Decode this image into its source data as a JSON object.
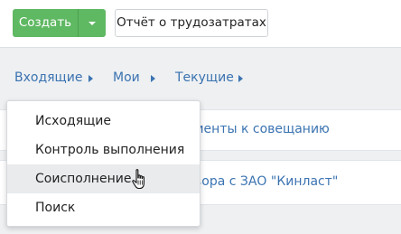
{
  "toolbar": {
    "create_label": "Создать",
    "report_label": "Отчёт о трудозатратах"
  },
  "breadcrumbs": {
    "items": [
      {
        "label": "Входящие"
      },
      {
        "label": "Мои"
      },
      {
        "label": "Текущие"
      }
    ]
  },
  "content": {
    "rows": [
      {
        "text": "менты к совещанию"
      },
      {
        "text": "вора с ЗАО \"Кинласт\""
      }
    ]
  },
  "dropdown": {
    "items": [
      {
        "label": "Исходящие"
      },
      {
        "label": "Контроль выполнения"
      },
      {
        "label": "Соисполнение",
        "hovered": true
      },
      {
        "label": "Поиск"
      }
    ]
  },
  "colors": {
    "accent_green": "#5fb862",
    "link_blue": "#3b73b1"
  },
  "icons": {
    "caret": "chevron-down-icon",
    "breadcrumb_arrow": "chevron-right-icon",
    "cursor": "hand-pointer-icon"
  }
}
